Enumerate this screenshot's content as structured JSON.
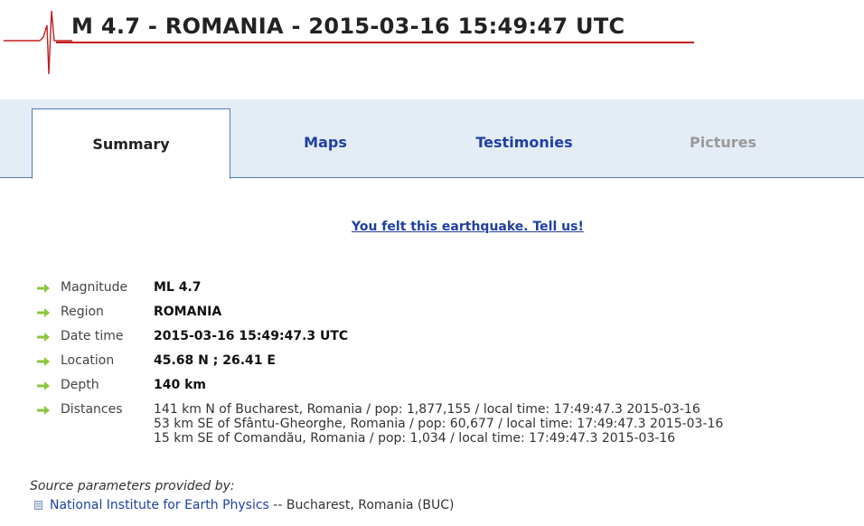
{
  "header": {
    "title": "M 4.7 - ROMANIA - 2015-03-16 15:49:47 UTC",
    "rule_color": "#c41e1e",
    "icon": "seismogram-icon"
  },
  "tabs": {
    "summary": "Summary",
    "maps": "Maps",
    "testimonies": "Testimonies",
    "pictures": "Pictures"
  },
  "felt_link": "You felt this earthquake. Tell us!",
  "details": {
    "magnitude": {
      "label": "Magnitude",
      "value": "ML 4.7"
    },
    "region": {
      "label": "Region",
      "value": "ROMANIA"
    },
    "datetime": {
      "label": "Date time",
      "value": "2015-03-16 15:49:47.3 UTC"
    },
    "location": {
      "label": "Location",
      "value": "45.68 N ; 26.41 E"
    },
    "depth": {
      "label": "Depth",
      "value": "140 km"
    },
    "distances": {
      "label": "Distances",
      "items": [
        "141 km N of Bucharest, Romania / pop: 1,877,155 / local time: 17:49:47.3 2015-03-16",
        "53 km SE of Sfântu-Gheorghe, Romania / pop: 60,677 / local time: 17:49:47.3 2015-03-16",
        "15 km SE of Comandău, Romania / pop: 1,034 / local time: 17:49:47.3 2015-03-16"
      ]
    }
  },
  "source": {
    "title": "Source parameters provided by:",
    "agency": "National Institute for Earth Physics",
    "suffix": " -- Bucharest, Romania (BUC)"
  },
  "colors": {
    "link": "#1f3fa3",
    "arrow": "#8cc63f",
    "tabbar": "#e4edf6",
    "tab_border": "#4d7ab8"
  }
}
